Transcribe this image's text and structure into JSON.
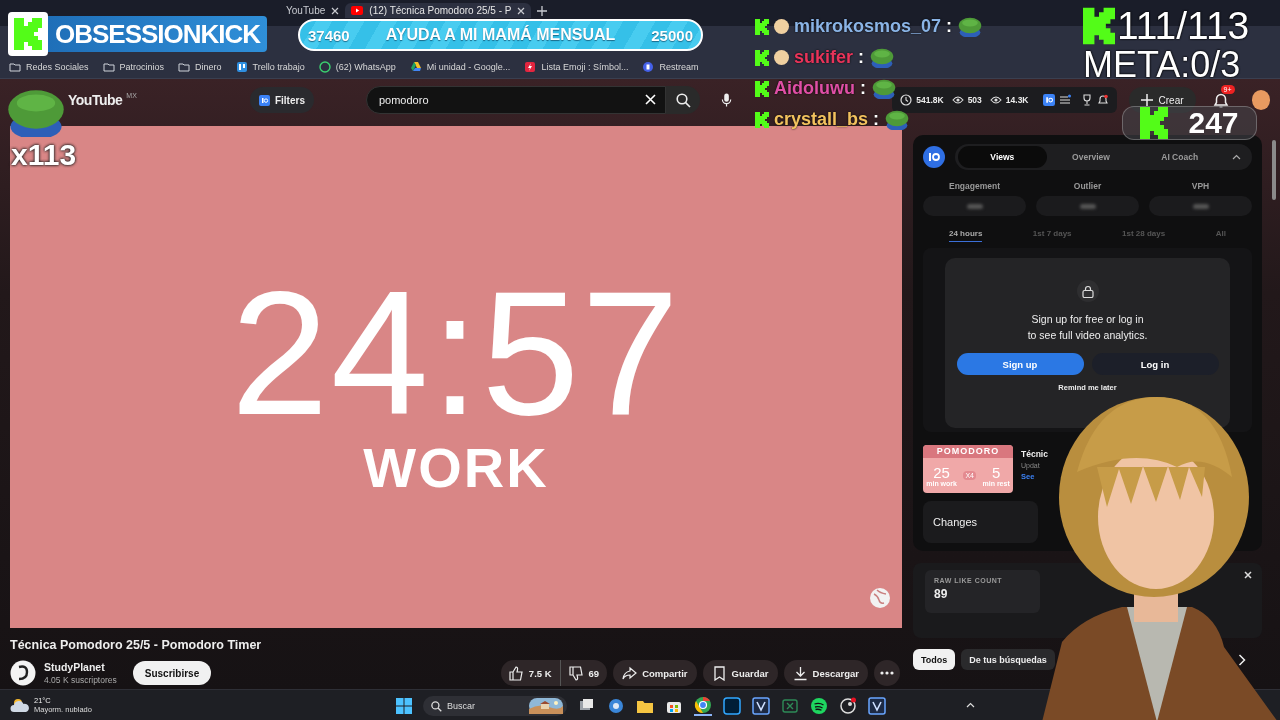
{
  "browser": {
    "tabs": [
      {
        "title": "YouTube",
        "selected": false
      },
      {
        "title": "(12) Técnica Pomodoro 25/5 - P",
        "selected": true
      }
    ],
    "bookmarks": [
      {
        "label": "Redes Sociales",
        "kind": "folder"
      },
      {
        "label": "Patrocinios",
        "kind": "folder"
      },
      {
        "label": "Dinero",
        "kind": "folder"
      },
      {
        "label": "Trello trabajo",
        "kind": "trello"
      },
      {
        "label": "(62) WhatsApp",
        "kind": "whatsapp"
      },
      {
        "label": "Mi unidad - Google...",
        "kind": "drive"
      },
      {
        "label": "Lista Emoji : Símbol...",
        "kind": "bolt"
      },
      {
        "label": "Restream",
        "kind": "restream"
      }
    ]
  },
  "youtube": {
    "logo": "YouTube",
    "region": "MX",
    "filters": "Filters",
    "search": {
      "value": "pomodoro"
    },
    "stats": [
      "541.8K",
      "503",
      "14.3K"
    ],
    "create": "Crear",
    "notifications": "9+",
    "video": {
      "time": "24:57",
      "phase": "WORK",
      "title": "Técnica Pomodoro 25/5 - Pomodoro Timer",
      "channel": "StudyPlanet",
      "subscribers": "4.05 K suscriptores",
      "subscribe": "Suscribirse",
      "likes": "7.5 K",
      "dislikes": "69",
      "share": "Compartir",
      "save": "Guardar",
      "download": "Descargar"
    },
    "vidiq": {
      "tabs": [
        {
          "label": "Views",
          "selected": true
        },
        {
          "label": "Overview",
          "selected": false
        },
        {
          "label": "AI Coach",
          "selected": false
        }
      ],
      "metrics": [
        "Engagement",
        "Outlier",
        "VPH"
      ],
      "ranges": [
        {
          "label": "24 hours",
          "selected": true
        },
        {
          "label": "1st 7 days",
          "selected": false
        },
        {
          "label": "1st 28 days",
          "selected": false
        },
        {
          "label": "All",
          "selected": false
        }
      ],
      "prompt": {
        "message": "Sign up for free or log in\nto see full video analytics.",
        "signup": "Sign up",
        "login": "Log in",
        "remind": "Remind me later"
      },
      "thumbnail": {
        "heading": "POMODORO",
        "work": "25",
        "work_unit": "min work",
        "rounds": "X4",
        "rest": "5",
        "rest_unit": "min rest"
      },
      "video_title": "Técnic",
      "updated": "Updat",
      "link": "See",
      "changes": "Changes",
      "like_label": "RAW LIKE COUNT",
      "like_count": "89"
    },
    "chips": [
      {
        "label": "Todos",
        "selected": true
      },
      {
        "label": "De tus búsquedas",
        "selected": false
      }
    ]
  },
  "overlay": {
    "brand": "OBSESSIONKICK",
    "goal": {
      "current": "37460",
      "label": "AYUDA A MI MAMÁ MENSUAL",
      "target": "25000"
    },
    "chat": [
      {
        "user": "mikrokosmos_07",
        "color": "#8ab4e6",
        "avatar": true
      },
      {
        "user": "sukifer",
        "color": "#e8345a",
        "avatar": true
      },
      {
        "user": "Aidoluwu",
        "color": "#e04fa6",
        "avatar": false
      },
      {
        "user": "crystall_bs",
        "color": "#f2c25e",
        "avatar": false
      }
    ],
    "separator": ":",
    "counter": "111/113",
    "meta": "META:0/3",
    "followers": "247",
    "emote_count": "x113"
  },
  "taskbar": {
    "temperature": "21°C",
    "weather": "Mayorm. nublado",
    "search": {
      "placeholder": "Buscar"
    },
    "apps": [
      {
        "kind": "taskview"
      },
      {
        "kind": "settings"
      },
      {
        "kind": "files"
      },
      {
        "kind": "store"
      },
      {
        "kind": "chrome"
      },
      {
        "kind": "photoshop"
      },
      {
        "kind": "vegas"
      },
      {
        "kind": "sheet"
      },
      {
        "kind": "spotify"
      },
      {
        "kind": "steam"
      },
      {
        "kind": "vegas"
      }
    ]
  }
}
